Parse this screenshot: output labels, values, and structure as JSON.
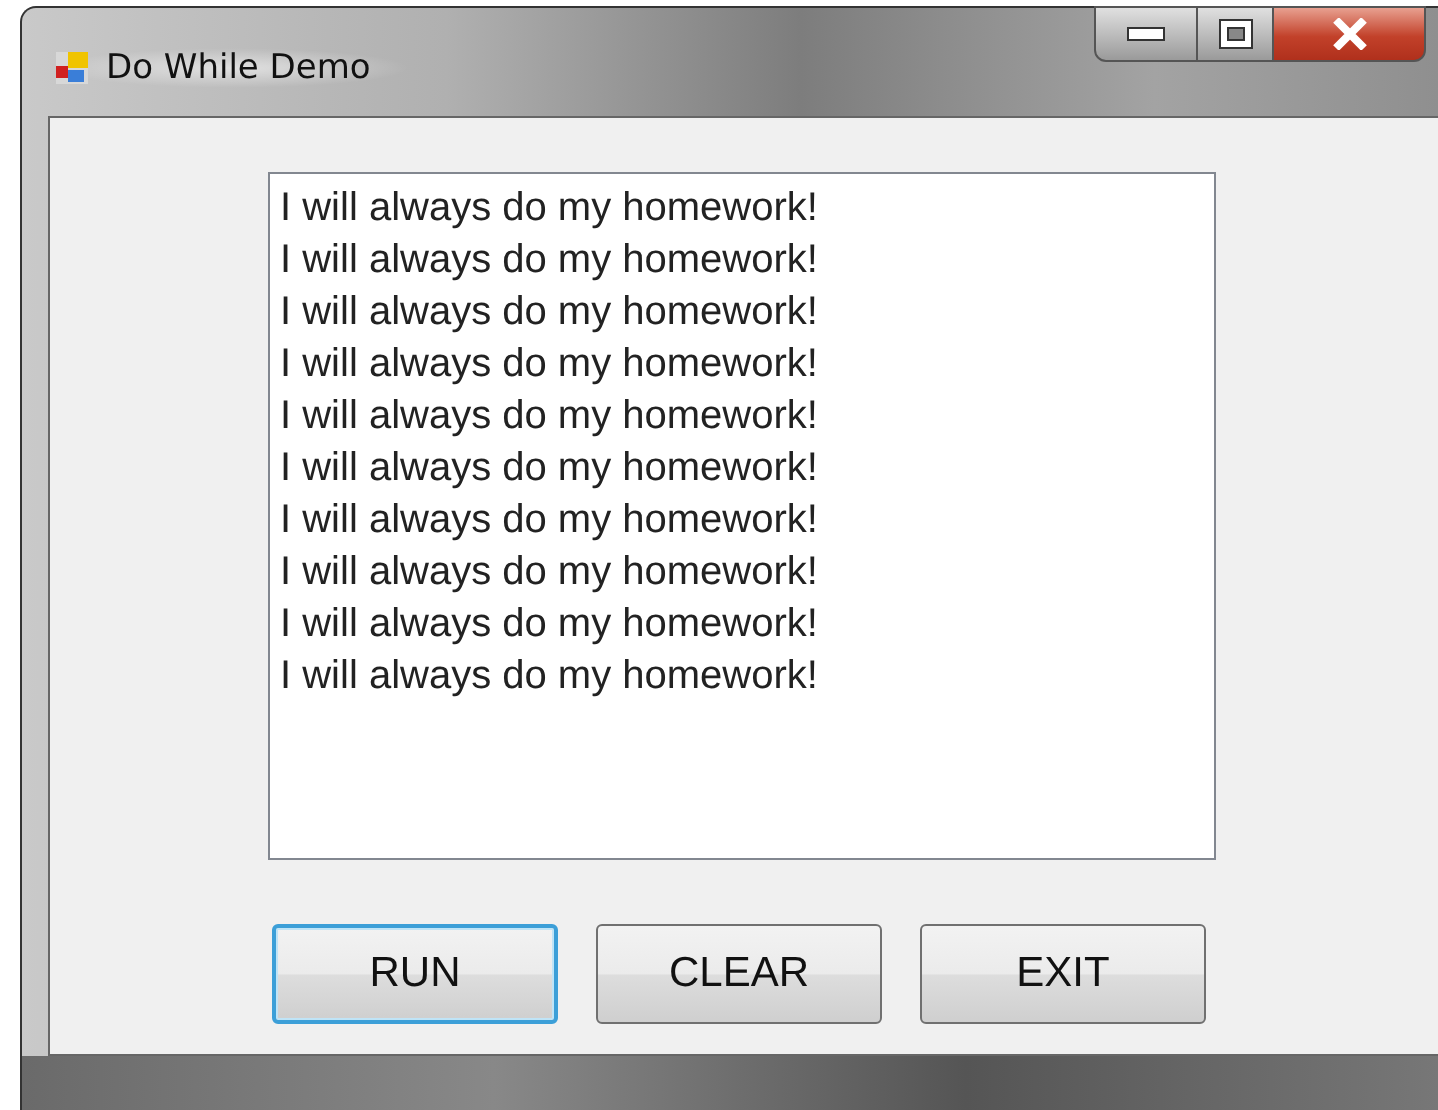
{
  "window": {
    "title": "Do While Demo"
  },
  "list_box": {
    "lines": [
      "I will always do my homework!",
      "I will always do my homework!",
      "I will always do my homework!",
      "I will always do my homework!",
      "I will always do my homework!",
      "I will always do my homework!",
      "I will always do my homework!",
      "I will always do my homework!",
      "I will always do my homework!",
      "I will always do my homework!"
    ]
  },
  "buttons": [
    {
      "label": "RUN",
      "focused": true
    },
    {
      "label": "CLEAR",
      "focused": false
    },
    {
      "label": "EXIT",
      "focused": false
    }
  ]
}
